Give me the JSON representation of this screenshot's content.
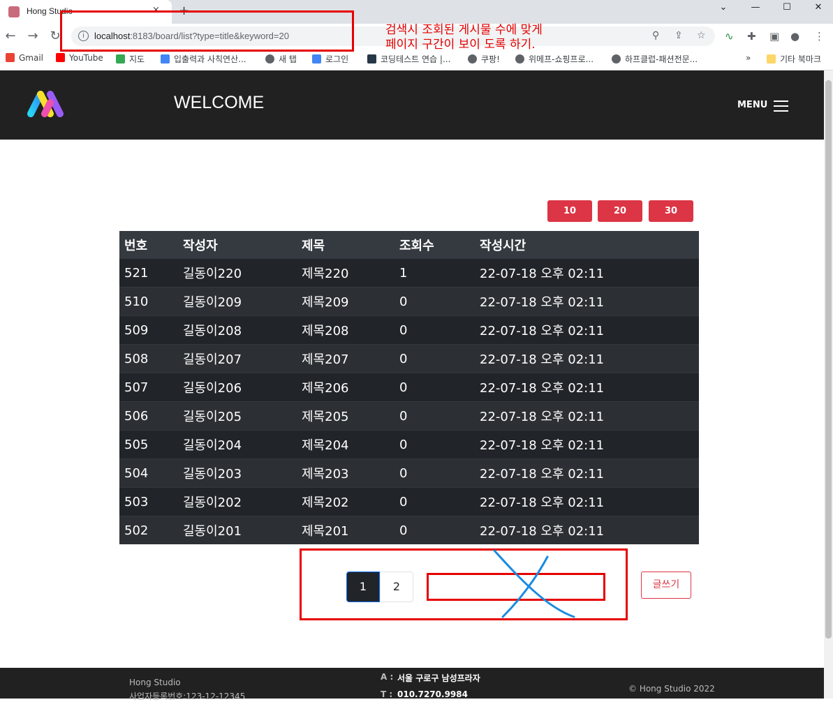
{
  "browser": {
    "tab_title": "Hong Studio",
    "tab_close": "×",
    "new_tab": "+",
    "url_host": "localhost",
    "url_rest": ":8183/board/list?type=title&keyword=20",
    "window_controls": [
      "⌄",
      "—",
      "☐",
      "✕"
    ],
    "bookmarks": [
      {
        "label": "Gmail",
        "color": "#ea4335"
      },
      {
        "label": "YouTube",
        "color": "#ff0000"
      },
      {
        "label": "지도",
        "color": "#34a853"
      },
      {
        "label": "입출력과 사칙연산...",
        "color": "#4285f4"
      },
      {
        "label": "새 탭",
        "color": "#5f6368"
      },
      {
        "label": "로그인",
        "color": "#4285f4"
      },
      {
        "label": "코딩테스트 연습 |...",
        "color": "#263747"
      },
      {
        "label": "쿠팡!",
        "color": "#5f6368"
      },
      {
        "label": "위메프-쇼핑프로...",
        "color": "#5f6368"
      },
      {
        "label": "하프클럽-패션전문...",
        "color": "#5f6368"
      }
    ],
    "bookmarks_overflow": "»",
    "other_bookmarks": "기타 북마크"
  },
  "annotation": {
    "line1": "검색시 조회된 게시물 수에 맞게",
    "line2": "페이지 구간이 보이 도록 하기."
  },
  "header": {
    "welcome": "WELCOME",
    "menu_label": "MENU"
  },
  "page_size_buttons": [
    "10",
    "20",
    "30"
  ],
  "table": {
    "headers": [
      "번호",
      "작성자",
      "제목",
      "조회수",
      "작성시간"
    ],
    "rows": [
      [
        "521",
        "길동이220",
        "제목220",
        "1",
        "22-07-18 오후 02:11"
      ],
      [
        "510",
        "길동이209",
        "제목209",
        "0",
        "22-07-18 오후 02:11"
      ],
      [
        "509",
        "길동이208",
        "제목208",
        "0",
        "22-07-18 오후 02:11"
      ],
      [
        "508",
        "길동이207",
        "제목207",
        "0",
        "22-07-18 오후 02:11"
      ],
      [
        "507",
        "길동이206",
        "제목206",
        "0",
        "22-07-18 오후 02:11"
      ],
      [
        "506",
        "길동이205",
        "제목205",
        "0",
        "22-07-18 오후 02:11"
      ],
      [
        "505",
        "길동이204",
        "제목204",
        "0",
        "22-07-18 오후 02:11"
      ],
      [
        "504",
        "길동이203",
        "제목203",
        "0",
        "22-07-18 오후 02:11"
      ],
      [
        "503",
        "길동이202",
        "제목202",
        "0",
        "22-07-18 오후 02:11"
      ],
      [
        "502",
        "길동이201",
        "제목201",
        "0",
        "22-07-18 오후 02:11"
      ]
    ]
  },
  "pagination": {
    "pages": [
      "1",
      "2"
    ],
    "active": "1"
  },
  "write_button": "글쓰기",
  "footer": {
    "company": "Hong Studio",
    "biz_number": "사업자등록번호:123-12-12345",
    "address_label": "A :",
    "address": "서울 구로구 남성프라자",
    "phone_label": "T :",
    "phone": "010.7270.9984",
    "copyright": "© Hong Studio 2022"
  },
  "colors": {
    "accent_red": "#dc3545",
    "annotation_red": "#e60000",
    "annotation_blue": "#1a8be0",
    "header_bg": "#212121",
    "table_bg": "#212529"
  }
}
